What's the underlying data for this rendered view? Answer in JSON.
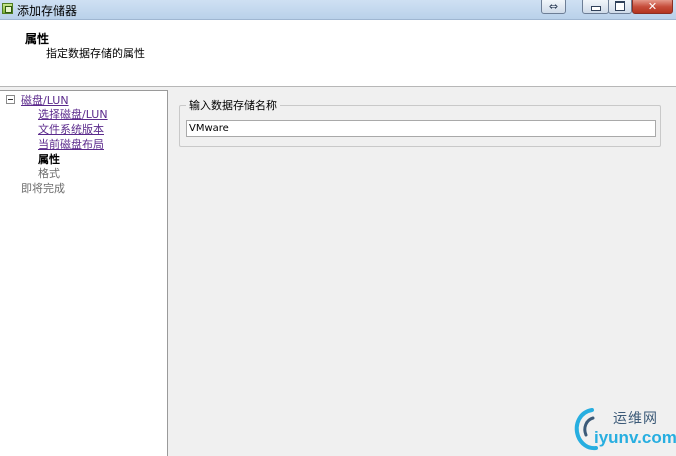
{
  "window": {
    "title": "添加存储器",
    "icon": "add-storage-icon",
    "controls": {
      "expand_icon": "⇔",
      "close_icon": "✕"
    }
  },
  "header": {
    "title": "属性",
    "subtitle": "指定数据存储的属性"
  },
  "nav": {
    "group": {
      "label": "磁盘/LUN",
      "toggle": "collapse-icon"
    },
    "items": [
      {
        "label": "选择磁盘/LUN",
        "state": "link"
      },
      {
        "label": "文件系统版本",
        "state": "link"
      },
      {
        "label": "当前磁盘布局",
        "state": "link"
      },
      {
        "label": "属性",
        "state": "current"
      },
      {
        "label": "格式",
        "state": "disabled"
      }
    ],
    "final": {
      "label": "即将完成",
      "state": "disabled"
    }
  },
  "content": {
    "group_label": "输入数据存储名称",
    "datastore_name": "VMware"
  },
  "watermark": {
    "cn": "运维网",
    "en": "iyunv.com"
  },
  "colors": {
    "link": "#5b2a8c",
    "disabled": "#6d6d6d",
    "close_button": "#c64d3b",
    "watermark_blue": "#27aee0"
  }
}
